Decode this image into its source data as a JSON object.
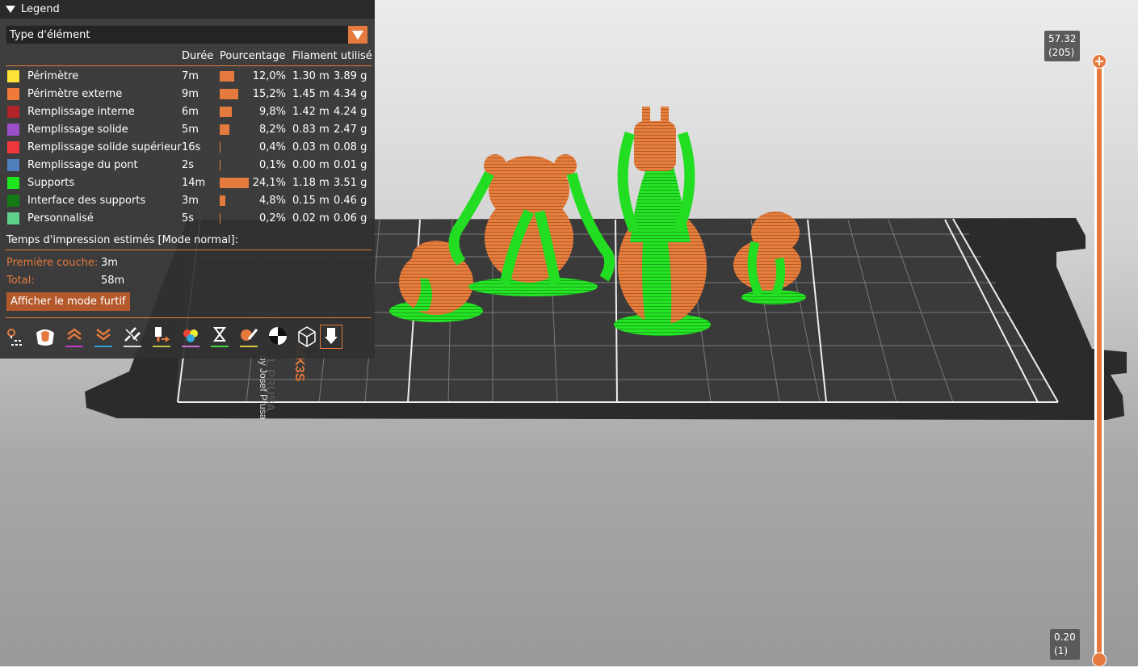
{
  "legend": {
    "title": "Legend",
    "view_type": "Type d'élément",
    "columns": {
      "duration": "Durée",
      "percentage": "Pourcentage",
      "filament": "Filament utilisé"
    },
    "features": [
      {
        "name": "Périmètre",
        "color": "#ffe23a",
        "duration": "7m",
        "percent": "12,0%",
        "ratio": 0.12,
        "length": "1.30 m",
        "weight": "3.89 g"
      },
      {
        "name": "Périmètre externe",
        "color": "#f07a39",
        "duration": "9m",
        "percent": "15,2%",
        "ratio": 0.152,
        "length": "1.45 m",
        "weight": "4.34 g"
      },
      {
        "name": "Remplissage interne",
        "color": "#b0242a",
        "duration": "6m",
        "percent": "9,8%",
        "ratio": 0.098,
        "length": "1.42 m",
        "weight": "4.24 g"
      },
      {
        "name": "Remplissage solide",
        "color": "#9a4fc8",
        "duration": "5m",
        "percent": "8,2%",
        "ratio": 0.082,
        "length": "0.83 m",
        "weight": "2.47 g"
      },
      {
        "name": "Remplissage solide supérieur",
        "color": "#f0373c",
        "duration": "16s",
        "percent": "0,4%",
        "ratio": 0.004,
        "length": "0.03 m",
        "weight": "0.08 g"
      },
      {
        "name": "Remplissage du pont",
        "color": "#4f80bd",
        "duration": "2s",
        "percent": "0,1%",
        "ratio": 0.001,
        "length": "0.00 m",
        "weight": "0.01 g"
      },
      {
        "name": "Supports",
        "color": "#1ee51e",
        "duration": "14m",
        "percent": "24,1%",
        "ratio": 0.241,
        "length": "1.18 m",
        "weight": "3.51 g"
      },
      {
        "name": "Interface des supports",
        "color": "#147a14",
        "duration": "3m",
        "percent": "4,8%",
        "ratio": 0.048,
        "length": "0.15 m",
        "weight": "0.46 g"
      },
      {
        "name": "Personnalisé",
        "color": "#5ed08c",
        "duration": "5s",
        "percent": "0,2%",
        "ratio": 0.002,
        "length": "0.02 m",
        "weight": "0.06 g"
      }
    ],
    "estimated_label": "Temps d'impression estimés [Mode normal]:",
    "first_layer_label": "Première couche:",
    "first_layer_value": "3m",
    "total_label": "Total:",
    "total_value": "58m",
    "stealth_button": "Afficher le mode furtif",
    "toolbar_icons": [
      "travel-icon",
      "wipe-icon",
      "retractions-icon",
      "deretractions-icon",
      "seams-icon",
      "tool-changes-icon",
      "color-changes-icon",
      "pause-icon",
      "custom-gcode-icon",
      "center-of-gravity-icon",
      "shells-icon",
      "tool-marker-icon"
    ]
  },
  "slider": {
    "top_height": "57.32",
    "top_layer": "(205)",
    "bottom_height": "0.20",
    "bottom_layer": "(1)",
    "color": "#e47a3d"
  },
  "bed": {
    "brand_text": "ORIGINAL PRUSA",
    "model_text": "MK3S",
    "author_text": "by Josef Prusa"
  }
}
